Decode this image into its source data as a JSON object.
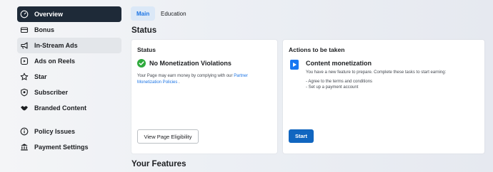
{
  "sidebar": {
    "items": [
      {
        "label": "Overview",
        "icon": "gauge-icon"
      },
      {
        "label": "Bonus",
        "icon": "bonus-icon"
      },
      {
        "label": "In-Stream Ads",
        "icon": "megaphone-icon"
      },
      {
        "label": "Ads on Reels",
        "icon": "reels-icon"
      },
      {
        "label": "Star",
        "icon": "star-icon"
      },
      {
        "label": "Subscriber",
        "icon": "subscriber-icon"
      },
      {
        "label": "Branded Content",
        "icon": "handshake-icon"
      },
      {
        "label": "Policy Issues",
        "icon": "info-icon"
      },
      {
        "label": "Payment Settings",
        "icon": "bank-icon"
      }
    ],
    "active_item": "Overview",
    "hover_item": "In-Stream Ads"
  },
  "tabs": [
    {
      "label": "Main",
      "active": true
    },
    {
      "label": "Education",
      "active": false
    }
  ],
  "main": {
    "status_heading": "Status",
    "features_heading": "Your Features"
  },
  "status_card": {
    "title": "Status",
    "status_text": "No Monetization Violations",
    "description_prefix": "Your Page may earn money by complying with our",
    "description_link": "Partner Monetization Policies",
    "description_suffix": ".",
    "button_label": "View Page Eligibility"
  },
  "actions_card": {
    "title": "Actions to be taken",
    "item_title": "Content monetization",
    "item_description": "You have a new feature to prepare. Complete these tasks to start earning:",
    "tasks": [
      "- Agree to the terms and conditions",
      "- Set up a payment account"
    ],
    "button_label": "Start"
  },
  "colors": {
    "sidebar_active_bg": "#1e2a38",
    "accent": "#1b74e4",
    "primary_button": "#1166c0",
    "success": "#2eaa3c"
  }
}
